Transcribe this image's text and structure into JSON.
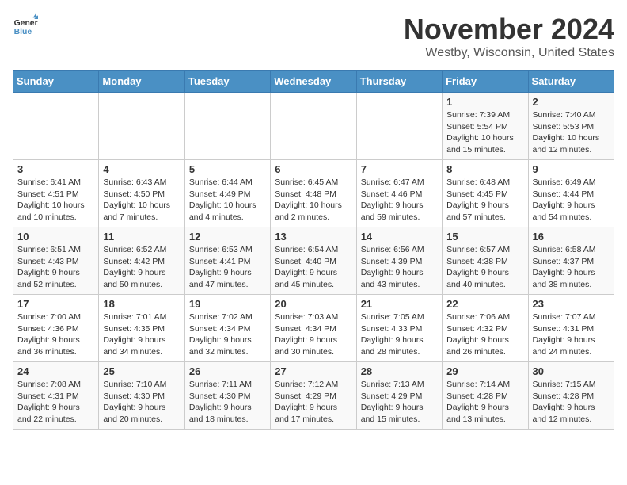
{
  "logo": {
    "line1": "General",
    "line2": "Blue"
  },
  "header": {
    "month": "November 2024",
    "location": "Westby, Wisconsin, United States"
  },
  "weekdays": [
    "Sunday",
    "Monday",
    "Tuesday",
    "Wednesday",
    "Thursday",
    "Friday",
    "Saturday"
  ],
  "weeks": [
    [
      {
        "day": "",
        "info": ""
      },
      {
        "day": "",
        "info": ""
      },
      {
        "day": "",
        "info": ""
      },
      {
        "day": "",
        "info": ""
      },
      {
        "day": "",
        "info": ""
      },
      {
        "day": "1",
        "info": "Sunrise: 7:39 AM\nSunset: 5:54 PM\nDaylight: 10 hours and 15 minutes."
      },
      {
        "day": "2",
        "info": "Sunrise: 7:40 AM\nSunset: 5:53 PM\nDaylight: 10 hours and 12 minutes."
      }
    ],
    [
      {
        "day": "3",
        "info": "Sunrise: 6:41 AM\nSunset: 4:51 PM\nDaylight: 10 hours and 10 minutes."
      },
      {
        "day": "4",
        "info": "Sunrise: 6:43 AM\nSunset: 4:50 PM\nDaylight: 10 hours and 7 minutes."
      },
      {
        "day": "5",
        "info": "Sunrise: 6:44 AM\nSunset: 4:49 PM\nDaylight: 10 hours and 4 minutes."
      },
      {
        "day": "6",
        "info": "Sunrise: 6:45 AM\nSunset: 4:48 PM\nDaylight: 10 hours and 2 minutes."
      },
      {
        "day": "7",
        "info": "Sunrise: 6:47 AM\nSunset: 4:46 PM\nDaylight: 9 hours and 59 minutes."
      },
      {
        "day": "8",
        "info": "Sunrise: 6:48 AM\nSunset: 4:45 PM\nDaylight: 9 hours and 57 minutes."
      },
      {
        "day": "9",
        "info": "Sunrise: 6:49 AM\nSunset: 4:44 PM\nDaylight: 9 hours and 54 minutes."
      }
    ],
    [
      {
        "day": "10",
        "info": "Sunrise: 6:51 AM\nSunset: 4:43 PM\nDaylight: 9 hours and 52 minutes."
      },
      {
        "day": "11",
        "info": "Sunrise: 6:52 AM\nSunset: 4:42 PM\nDaylight: 9 hours and 50 minutes."
      },
      {
        "day": "12",
        "info": "Sunrise: 6:53 AM\nSunset: 4:41 PM\nDaylight: 9 hours and 47 minutes."
      },
      {
        "day": "13",
        "info": "Sunrise: 6:54 AM\nSunset: 4:40 PM\nDaylight: 9 hours and 45 minutes."
      },
      {
        "day": "14",
        "info": "Sunrise: 6:56 AM\nSunset: 4:39 PM\nDaylight: 9 hours and 43 minutes."
      },
      {
        "day": "15",
        "info": "Sunrise: 6:57 AM\nSunset: 4:38 PM\nDaylight: 9 hours and 40 minutes."
      },
      {
        "day": "16",
        "info": "Sunrise: 6:58 AM\nSunset: 4:37 PM\nDaylight: 9 hours and 38 minutes."
      }
    ],
    [
      {
        "day": "17",
        "info": "Sunrise: 7:00 AM\nSunset: 4:36 PM\nDaylight: 9 hours and 36 minutes."
      },
      {
        "day": "18",
        "info": "Sunrise: 7:01 AM\nSunset: 4:35 PM\nDaylight: 9 hours and 34 minutes."
      },
      {
        "day": "19",
        "info": "Sunrise: 7:02 AM\nSunset: 4:34 PM\nDaylight: 9 hours and 32 minutes."
      },
      {
        "day": "20",
        "info": "Sunrise: 7:03 AM\nSunset: 4:34 PM\nDaylight: 9 hours and 30 minutes."
      },
      {
        "day": "21",
        "info": "Sunrise: 7:05 AM\nSunset: 4:33 PM\nDaylight: 9 hours and 28 minutes."
      },
      {
        "day": "22",
        "info": "Sunrise: 7:06 AM\nSunset: 4:32 PM\nDaylight: 9 hours and 26 minutes."
      },
      {
        "day": "23",
        "info": "Sunrise: 7:07 AM\nSunset: 4:31 PM\nDaylight: 9 hours and 24 minutes."
      }
    ],
    [
      {
        "day": "24",
        "info": "Sunrise: 7:08 AM\nSunset: 4:31 PM\nDaylight: 9 hours and 22 minutes."
      },
      {
        "day": "25",
        "info": "Sunrise: 7:10 AM\nSunset: 4:30 PM\nDaylight: 9 hours and 20 minutes."
      },
      {
        "day": "26",
        "info": "Sunrise: 7:11 AM\nSunset: 4:30 PM\nDaylight: 9 hours and 18 minutes."
      },
      {
        "day": "27",
        "info": "Sunrise: 7:12 AM\nSunset: 4:29 PM\nDaylight: 9 hours and 17 minutes."
      },
      {
        "day": "28",
        "info": "Sunrise: 7:13 AM\nSunset: 4:29 PM\nDaylight: 9 hours and 15 minutes."
      },
      {
        "day": "29",
        "info": "Sunrise: 7:14 AM\nSunset: 4:28 PM\nDaylight: 9 hours and 13 minutes."
      },
      {
        "day": "30",
        "info": "Sunrise: 7:15 AM\nSunset: 4:28 PM\nDaylight: 9 hours and 12 minutes."
      }
    ]
  ]
}
